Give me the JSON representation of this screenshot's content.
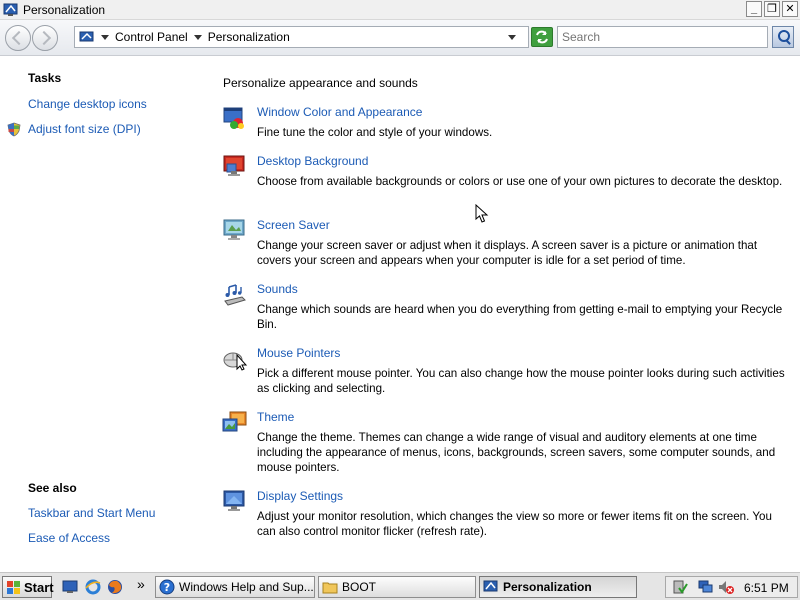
{
  "window": {
    "title": "Personalization"
  },
  "titlebar_buttons": {
    "minimize": "_",
    "maximize": "❐",
    "close": "✕"
  },
  "address": {
    "crumbs": [
      "Control Panel",
      "Personalization"
    ],
    "search_placeholder": "Search"
  },
  "sidebar": {
    "tasks_heading": "Tasks",
    "tasks": [
      {
        "label": "Change desktop icons",
        "icon": ""
      },
      {
        "label": "Adjust font size (DPI)",
        "icon": "shield-icon"
      }
    ],
    "see_also_heading": "See also",
    "see_also": [
      {
        "label": "Taskbar and Start Menu"
      },
      {
        "label": "Ease of Access"
      }
    ]
  },
  "main": {
    "heading": "Personalize appearance and sounds",
    "items": [
      {
        "title": "Window Color and Appearance",
        "icon": "window-color-icon",
        "desc": "Fine tune the color and style of your windows."
      },
      {
        "title": "Desktop Background",
        "icon": "desktop-background-icon",
        "desc": "Choose from available backgrounds or colors or use one of your own pictures to decorate the desktop."
      },
      {
        "title": "Screen Saver",
        "icon": "screen-saver-icon",
        "desc": "Change your screen saver or adjust when it displays. A screen saver is a picture or animation that covers your screen and appears when your computer is idle for a set period of time."
      },
      {
        "title": "Sounds",
        "icon": "sounds-icon",
        "desc": "Change which sounds are heard when you do everything from getting e-mail to emptying your Recycle Bin."
      },
      {
        "title": "Mouse Pointers",
        "icon": "mouse-pointers-icon",
        "desc": "Pick a different mouse pointer. You can also change how the mouse pointer looks during such activities as clicking and selecting."
      },
      {
        "title": "Theme",
        "icon": "theme-icon",
        "desc": "Change the theme. Themes can change a wide range of visual and auditory elements at one time including the appearance of menus, icons, backgrounds, screen savers, some computer sounds, and mouse pointers."
      },
      {
        "title": "Display Settings",
        "icon": "display-settings-icon",
        "desc": "Adjust your monitor resolution, which changes the view so more or fewer items fit on the screen. You can also control monitor flicker (refresh rate)."
      }
    ]
  },
  "taskbar": {
    "start_label": "Start",
    "overflow": "»",
    "tasks": [
      {
        "label": "Windows Help and Sup...",
        "icon": "help-icon",
        "active": false
      },
      {
        "label": "BOOT",
        "icon": "folder-icon",
        "active": false
      },
      {
        "label": "Personalization",
        "icon": "control-panel-icon",
        "active": true
      }
    ],
    "clock": "6:51 PM"
  },
  "colors": {
    "link": "#1c5bb5",
    "accent_green": "#3f9f3f"
  }
}
